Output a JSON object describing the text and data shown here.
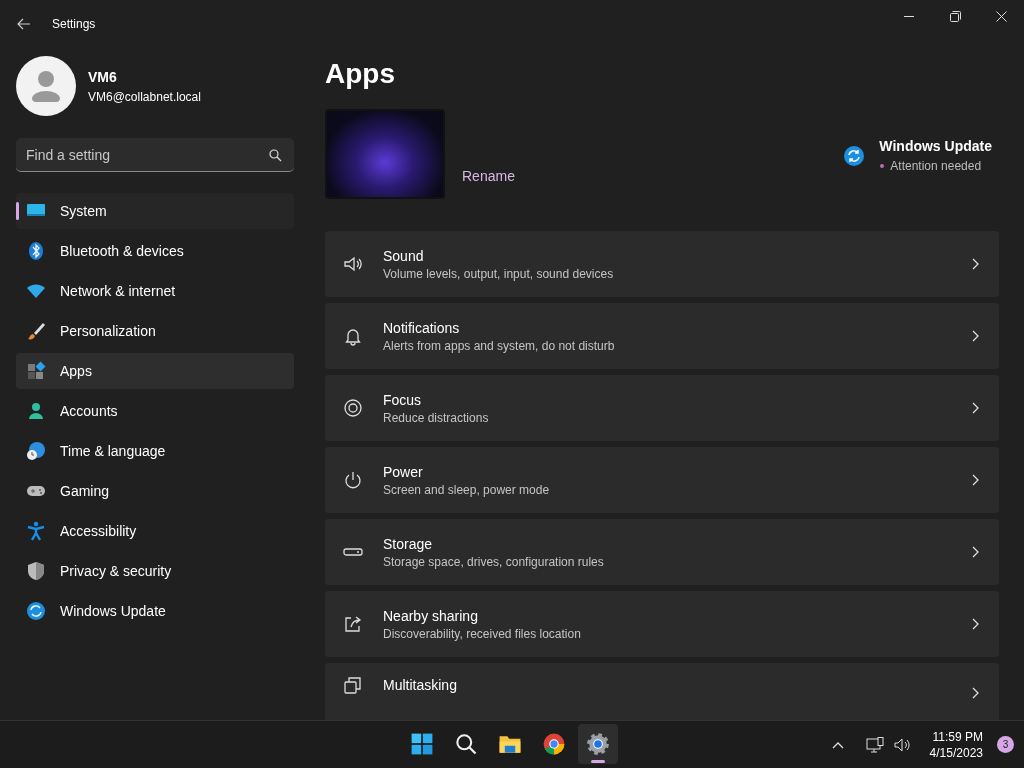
{
  "window": {
    "title": "Settings"
  },
  "user": {
    "name": "VM6",
    "email": "VM6@collabnet.local"
  },
  "search": {
    "placeholder": "Find a setting"
  },
  "sidebar": {
    "items": [
      {
        "label": "System",
        "selected": true,
        "hovered": false
      },
      {
        "label": "Bluetooth & devices",
        "selected": false,
        "hovered": false
      },
      {
        "label": "Network & internet",
        "selected": false,
        "hovered": false
      },
      {
        "label": "Personalization",
        "selected": false,
        "hovered": false
      },
      {
        "label": "Apps",
        "selected": false,
        "hovered": true
      },
      {
        "label": "Accounts",
        "selected": false,
        "hovered": false
      },
      {
        "label": "Time & language",
        "selected": false,
        "hovered": false
      },
      {
        "label": "Gaming",
        "selected": false,
        "hovered": false
      },
      {
        "label": "Accessibility",
        "selected": false,
        "hovered": false
      },
      {
        "label": "Privacy & security",
        "selected": false,
        "hovered": false
      },
      {
        "label": "Windows Update",
        "selected": false,
        "hovered": false
      }
    ]
  },
  "page": {
    "title": "Apps",
    "rename": "Rename",
    "update": {
      "title": "Windows Update",
      "status": "Attention needed",
      "color": "#b36fb0"
    }
  },
  "cards": [
    {
      "title": "Sound",
      "subtitle": "Volume levels, output, input, sound devices"
    },
    {
      "title": "Notifications",
      "subtitle": "Alerts from apps and system, do not disturb"
    },
    {
      "title": "Focus",
      "subtitle": "Reduce distractions"
    },
    {
      "title": "Power",
      "subtitle": "Screen and sleep, power mode"
    },
    {
      "title": "Storage",
      "subtitle": "Storage space, drives, configuration rules"
    },
    {
      "title": "Nearby sharing",
      "subtitle": "Discoverability, received files location"
    },
    {
      "title": "Multitasking"
    }
  ],
  "taskbar": {
    "apps": [
      {
        "selected": false
      },
      {
        "selected": false
      },
      {
        "selected": false
      },
      {
        "selected": false
      },
      {
        "selected": true
      }
    ],
    "time": "11:59 PM",
    "date": "4/15/2023",
    "notifications": "3"
  }
}
